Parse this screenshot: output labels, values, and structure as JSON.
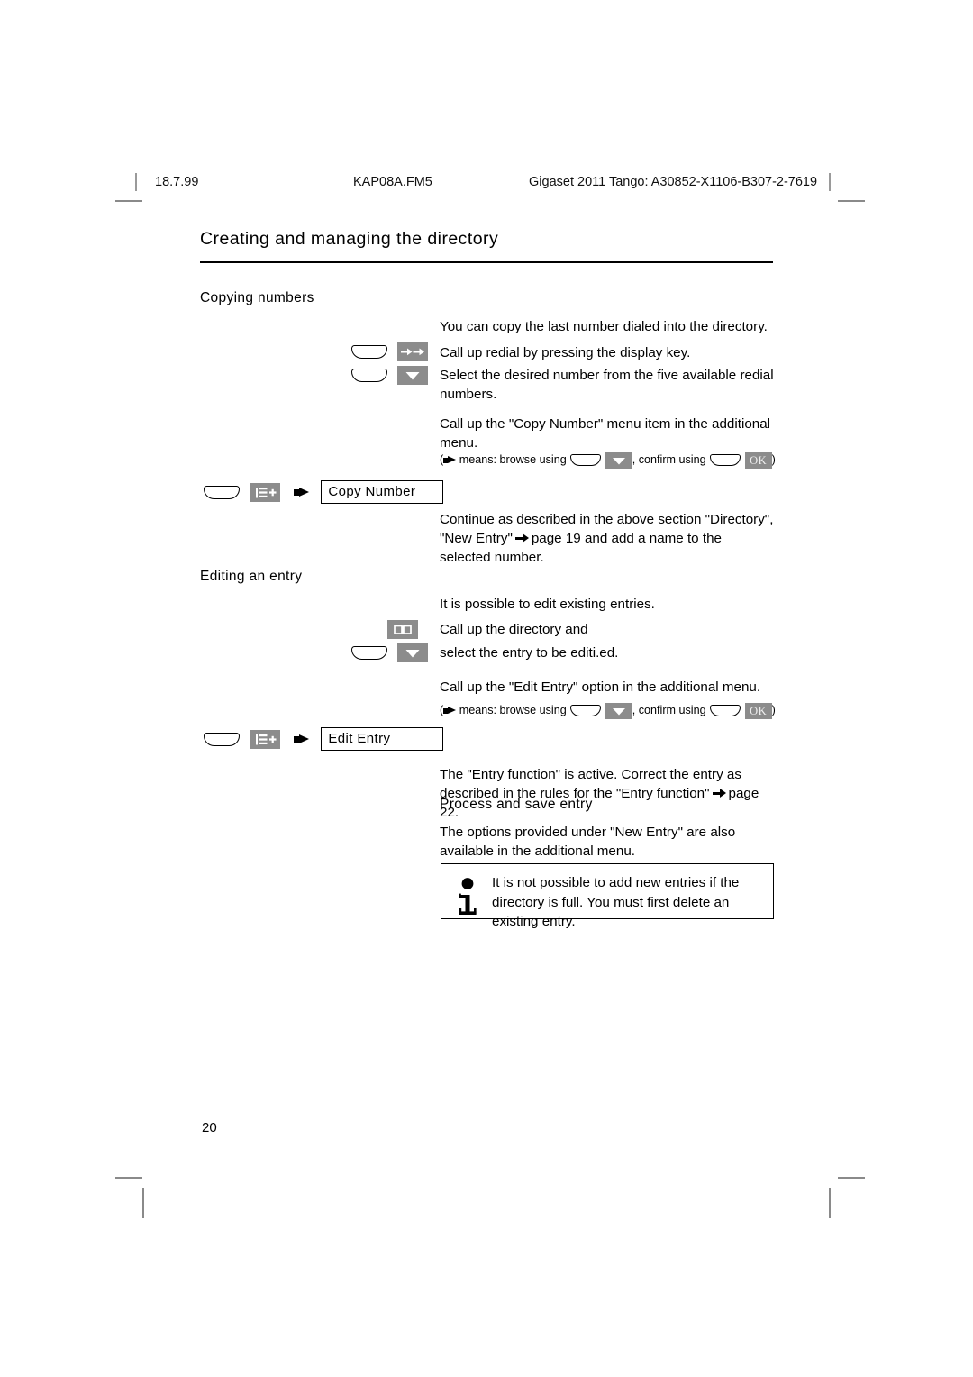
{
  "header": {
    "date": "18.7.99",
    "file": "KAP08A.FM5",
    "doc_id": "Gigaset 2011 Tango: A30852-X1106-B307-2-7619"
  },
  "chapter_title": "Creating and managing the directory",
  "sections": {
    "copying_numbers": {
      "heading": "Copying numbers",
      "intro": "You can copy the last number dialed into the directory.",
      "step_redial": "Call up redial by pressing the display key.",
      "step_select": "Select the desired number from the five available redial numbers.",
      "step_menu": "Call up the \"Copy Number\" menu item in the additional menu.",
      "legend_prefix": "means: browse using",
      "legend_middle": ", confirm using",
      "legend_open": "(",
      "legend_close": ")",
      "menu_item_label": "Copy Number",
      "continue_text_1": "Continue as described in the above section \"Directory\", \"New Entry\"",
      "continue_text_2": "page 19 and add a name to the selected number."
    },
    "editing_entry": {
      "heading": "Editing an entry",
      "intro": "It is possible to edit existing entries.",
      "step_directory": "Call up the directory and",
      "step_select": "select the entry to be editi.ed.",
      "step_menu": "Call up the \"Edit Entry\" option in the additional menu.",
      "legend_prefix": "means: browse using",
      "legend_middle": ", confirm using",
      "legend_open": "(",
      "legend_close": ")",
      "menu_item_label": "Edit Entry",
      "after_text_1": "The \"Entry function\" is active. Correct the entry as described in the rules for the \"Entry function\"",
      "after_text_2": "page 22."
    },
    "process_save": {
      "heading": "Process and save entry",
      "body": "The options provided under \"New Entry\" are also available in the additional menu."
    }
  },
  "note": {
    "text": "It is not possible to add new entries if the directory is full. You must first delete an existing entry.",
    "icon": "info-i-icon"
  },
  "keys": {
    "ok_label": "OK",
    "redial_icon": "double-right-arrow-icon",
    "down_icon": "down-triangle-icon",
    "menu_icon": "list-plus-icon",
    "directory_icon": "open-book-icon",
    "softkey_icon": "blank-display-key-icon"
  },
  "page_number": "20",
  "colors": {
    "chip_gray": "#8c8c8c",
    "text_black": "#000000",
    "mark_gray": "#8a8a8a"
  }
}
